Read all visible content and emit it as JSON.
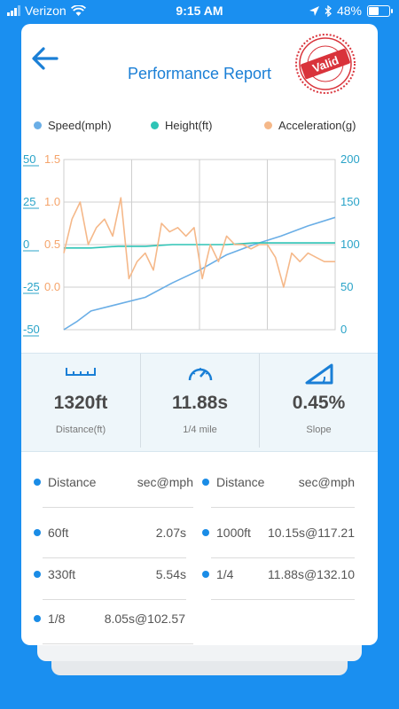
{
  "status_bar": {
    "carrier": "Verizon",
    "time": "9:15 AM",
    "battery": "48%",
    "battery_level": 0.48
  },
  "header": {
    "title": "Performance Report",
    "stamp": "Valid",
    "back_icon": "arrow-left-icon"
  },
  "legend": [
    {
      "label": "Speed(mph)",
      "color": "#6aaee6"
    },
    {
      "label": "Height(ft)",
      "color": "#2ec4b6"
    },
    {
      "label": "Acceleration(g)",
      "color": "#f5b889"
    }
  ],
  "chart_data": {
    "type": "line",
    "axes": {
      "height_ticks": [
        "50",
        "25",
        "0",
        "-25",
        "-50"
      ],
      "accel_ticks": [
        "1.5",
        "1.0",
        "0.5",
        "0.0"
      ],
      "speed_ticks": [
        "200",
        "150",
        "100",
        "50",
        "0"
      ],
      "height_range": [
        -50,
        50
      ],
      "accel_range": [
        -0.5,
        1.5
      ],
      "speed_range": [
        0,
        200
      ]
    },
    "grid": true,
    "series": [
      {
        "name": "Speed(mph)",
        "axis": "right",
        "color": "#6aaee6",
        "x": [
          0,
          0.05,
          0.1,
          0.2,
          0.3,
          0.4,
          0.5,
          0.6,
          0.7,
          0.8,
          0.9,
          1.0
        ],
        "values": [
          0,
          10,
          22,
          30,
          38,
          55,
          70,
          88,
          100,
          110,
          122,
          132
        ]
      },
      {
        "name": "Height(ft)",
        "axis": "left",
        "color": "#2ec4b6",
        "x": [
          0,
          0.1,
          0.2,
          0.3,
          0.4,
          0.5,
          0.6,
          0.7,
          0.8,
          0.9,
          1.0
        ],
        "values": [
          -2,
          -2,
          -1,
          -1,
          0,
          0,
          0,
          1,
          1,
          1,
          1
        ]
      },
      {
        "name": "Acceleration(g)",
        "axis": "accel",
        "color": "#f5b889",
        "x": [
          0,
          0.03,
          0.06,
          0.09,
          0.12,
          0.15,
          0.18,
          0.21,
          0.24,
          0.27,
          0.3,
          0.33,
          0.36,
          0.39,
          0.42,
          0.45,
          0.48,
          0.51,
          0.54,
          0.57,
          0.6,
          0.63,
          0.66,
          0.69,
          0.72,
          0.75,
          0.78,
          0.81,
          0.84,
          0.87,
          0.9,
          0.93,
          0.96,
          1.0
        ],
        "values": [
          0.4,
          0.8,
          1.0,
          0.5,
          0.7,
          0.8,
          0.6,
          1.05,
          0.1,
          0.3,
          0.4,
          0.2,
          0.75,
          0.65,
          0.7,
          0.6,
          0.7,
          0.1,
          0.5,
          0.3,
          0.6,
          0.5,
          0.5,
          0.45,
          0.5,
          0.5,
          0.35,
          0.0,
          0.4,
          0.3,
          0.4,
          0.35,
          0.3,
          0.3
        ]
      }
    ]
  },
  "stats": [
    {
      "value": "1320ft",
      "label": "Distance(ft)",
      "icon": "ruler-icon"
    },
    {
      "value": "11.88s",
      "label": "1/4 mile",
      "icon": "speedometer-icon"
    },
    {
      "value": "0.45%",
      "label": "Slope",
      "icon": "slope-icon"
    }
  ],
  "splits": [
    {
      "left": {
        "name": "Distance",
        "value": "sec@mph"
      },
      "right": {
        "name": "Distance",
        "value": "sec@mph"
      }
    },
    {
      "left": {
        "name": "60ft",
        "value": "2.07s"
      },
      "right": {
        "name": "1000ft",
        "value": "10.15s@117.21"
      }
    },
    {
      "left": {
        "name": "330ft",
        "value": "5.54s"
      },
      "right": {
        "name": "1/4",
        "value": "11.88s@132.10"
      }
    },
    {
      "left": {
        "name": "1/8",
        "value": "8.05s@102.57"
      }
    }
  ]
}
